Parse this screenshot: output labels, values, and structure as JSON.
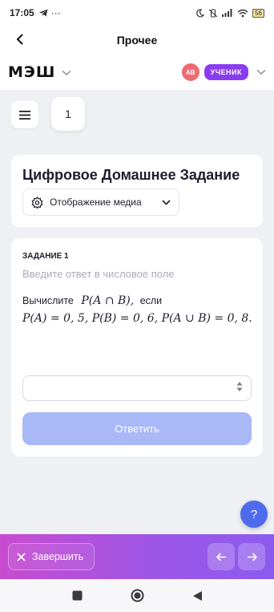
{
  "status_bar": {
    "time": "17:05",
    "battery": "56"
  },
  "top_bar": {
    "title": "Прочее"
  },
  "app_header": {
    "logo": "МЭШ",
    "avatar_initials": "AB",
    "role_badge": "УЧЕНИК"
  },
  "task_navigator": {
    "current_number": "1"
  },
  "title_card": {
    "title": "Цифровое Домашнее Задание",
    "media_button_label": "Отображение медиа"
  },
  "task": {
    "label": "ЗАДАНИЕ 1",
    "hint": "Введите ответ в числовое поле",
    "prompt_prefix": "Вычислите",
    "prompt_expression": "P(A ∩ B),",
    "prompt_suffix": "если",
    "given": "P(A) = 0, 5, P(B) = 0, 6, P(A ∪ B) = 0, 8.",
    "answer_value": "",
    "submit_label": "Ответить"
  },
  "help": {
    "label": "?"
  },
  "bottom_bar": {
    "finish_label": "Завершить"
  },
  "colors": {
    "accent_purple": "#8a3cf0",
    "submit_disabled": "#a9b8f7",
    "help_blue": "#4f6bed",
    "avatar_red": "#ee6a73"
  }
}
